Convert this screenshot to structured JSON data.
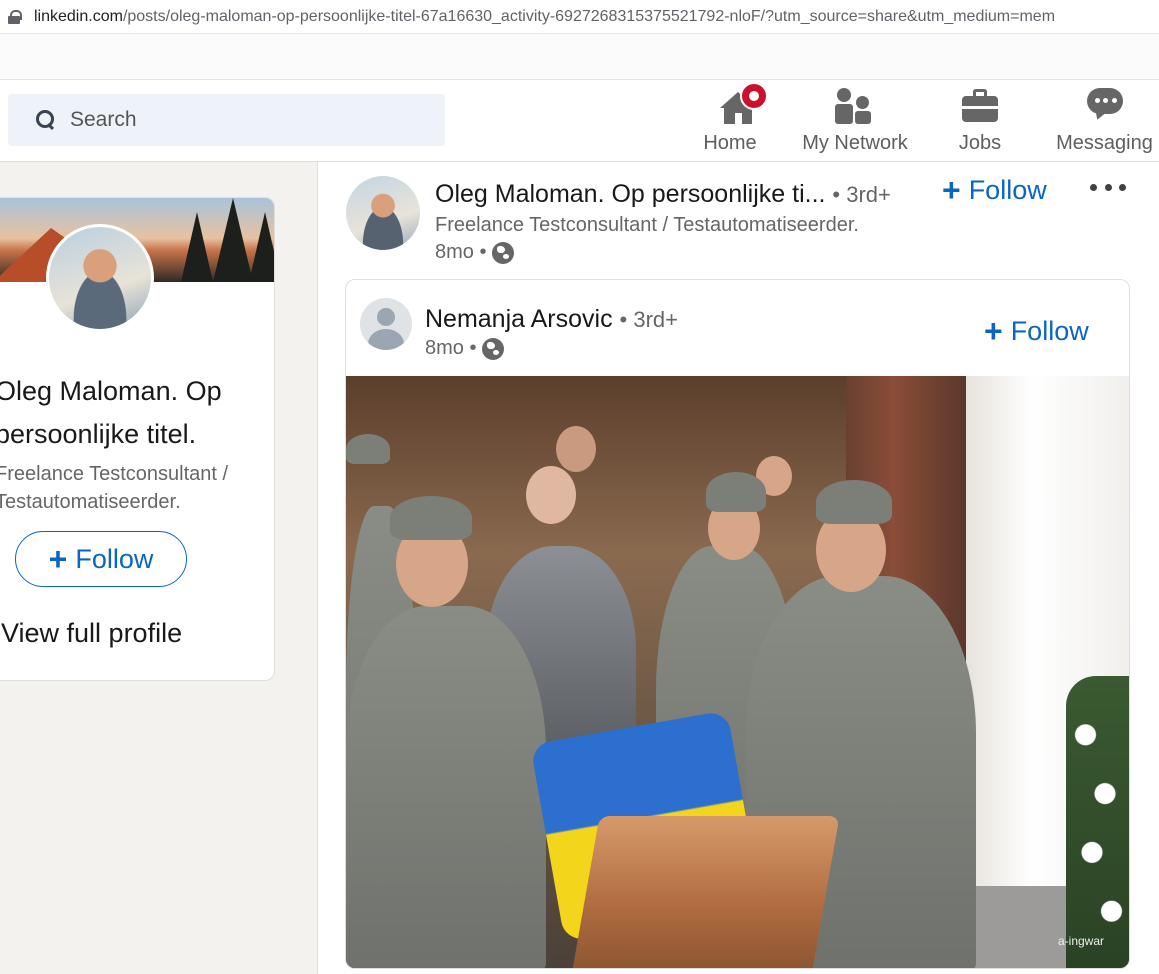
{
  "browser": {
    "url_host": "linkedin.com",
    "url_rest": "/posts/oleg-maloman-op-persoonlijke-titel-67a16630_activity-6927268315375521792-nloF/?utm_source=share&utm_medium=mem"
  },
  "nav": {
    "search_placeholder": "Search",
    "items": [
      {
        "label": "Home",
        "icon": "home-icon"
      },
      {
        "label": "My Network",
        "icon": "network-icon"
      },
      {
        "label": "Jobs",
        "icon": "briefcase-icon"
      },
      {
        "label": "Messaging",
        "icon": "messaging-icon"
      }
    ]
  },
  "profile_card": {
    "name": "Oleg Maloman. Op persoonlijke titel.",
    "headline": "Freelance Testconsultant / Testautomatiseerder.",
    "follow_label": "Follow",
    "view_profile_label": "View full profile"
  },
  "post": {
    "actor_name": "Oleg Maloman. Op persoonlijke ti...",
    "degree": "• 3rd+",
    "headline": "Freelance Testconsultant / Testautomatiseerder.",
    "time": "8mo •",
    "follow_label": "Follow",
    "reshare": {
      "actor_name": "Nemanja Arsovic",
      "degree": "• 3rd+",
      "time": "8mo •",
      "follow_label": "Follow",
      "image_watermark": "a-ingwar"
    }
  },
  "colors": {
    "brand_blue": "#0a66c2",
    "notification_red": "#cb112d"
  }
}
